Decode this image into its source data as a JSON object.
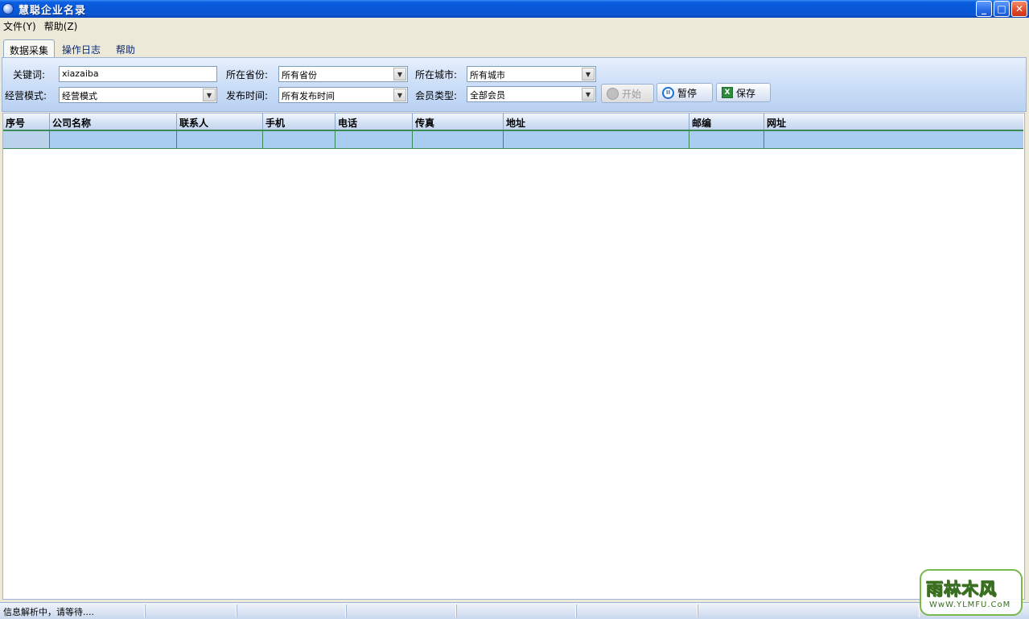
{
  "window": {
    "title": "慧聪企业名录",
    "controls": {
      "minimize": "_",
      "maximize": "□",
      "close": "✕"
    }
  },
  "menu": [
    "文件(Y)",
    "帮助(Z)"
  ],
  "tabs": [
    {
      "label": "数据采集",
      "active": true
    },
    {
      "label": "操作日志",
      "active": false
    },
    {
      "label": "帮助",
      "active": false
    }
  ],
  "form": {
    "keyword_label": "关键词:",
    "keyword_value": "xiazaiba",
    "province_label": "所在省份:",
    "province_value": "所有省份",
    "city_label": "所在城市:",
    "city_value": "所有城市",
    "mode_label": "经营模式:",
    "mode_value": "经营模式",
    "time_label": "发布时间:",
    "time_value": "所有发布时间",
    "member_label": "会员类型:",
    "member_value": "全部会员"
  },
  "buttons": {
    "start": "开始",
    "pause": "暂停",
    "save": "保存"
  },
  "icons": {
    "app": "app-globe-icon",
    "start": "start-circle-icon",
    "pause": "pause-icon",
    "save": "excel-icon"
  },
  "table": {
    "columns": [
      "序号",
      "公司名称",
      "联系人",
      "手机",
      "电话",
      "传真",
      "地址",
      "邮编",
      "网址"
    ],
    "rows": [
      [
        "",
        "",
        "",
        "",
        "",
        "",
        "",
        "",
        ""
      ]
    ]
  },
  "status": {
    "message": "信息解析中，请等待....",
    "cells": [
      "",
      "",
      "",
      "",
      "",
      ""
    ]
  },
  "watermark": {
    "brand": "雨林木风",
    "url": "WwW.YLMFU.CoM"
  },
  "colors": {
    "titlebar": "#0a5ee0",
    "grid_row": "#a9cdf0",
    "grid_line": "#3c8b56"
  }
}
